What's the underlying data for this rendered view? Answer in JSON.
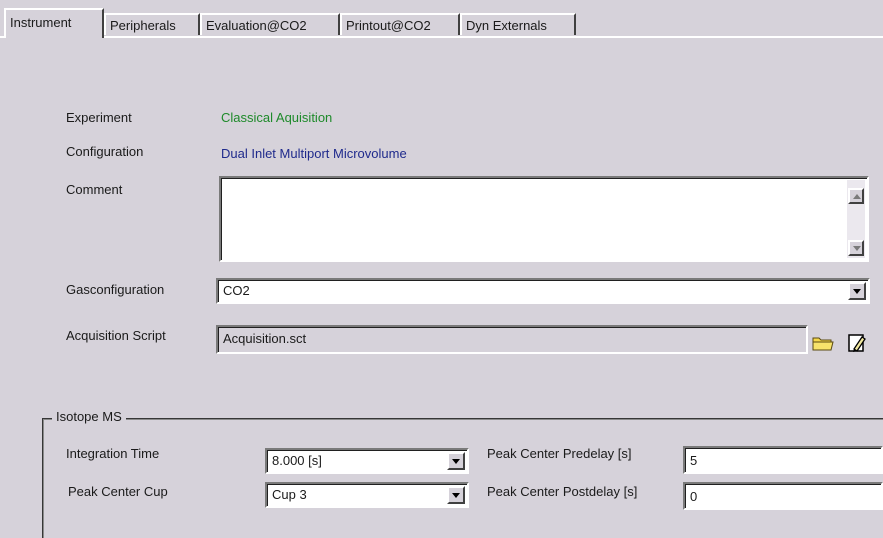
{
  "tabs": [
    {
      "label": "Instrument",
      "active": true
    },
    {
      "label": "Peripherals",
      "active": false
    },
    {
      "label": "Evaluation@CO2",
      "active": false
    },
    {
      "label": "Printout@CO2",
      "active": false
    },
    {
      "label": "Dyn Externals",
      "active": false
    }
  ],
  "instrument": {
    "experiment_label": "Experiment",
    "experiment_value": "Classical Aquisition",
    "configuration_label": "Configuration",
    "configuration_value": "Dual Inlet  Multiport  Microvolume",
    "comment_label": "Comment",
    "comment_value": "",
    "gasconfiguration_label": "Gasconfiguration",
    "gasconfiguration_value": "CO2",
    "acquisition_script_label": "Acquisition Script",
    "acquisition_script_value": "Acquisition.sct"
  },
  "isotope_ms": {
    "group_title": "Isotope MS",
    "integration_time_label": "Integration Time",
    "integration_time_value": "8.000 [s]",
    "peak_center_cup_label": "Peak Center Cup",
    "peak_center_cup_value": "Cup 3",
    "peak_center_predelay_label": "Peak Center Predelay [s]",
    "peak_center_predelay_value": "5",
    "peak_center_postdelay_label": "Peak Center Postdelay [s]",
    "peak_center_postdelay_value": "0"
  },
  "icons": {
    "browse": "folder-icon",
    "edit": "edit-pencil-icon"
  },
  "colors": {
    "background": "#d6d2da",
    "experiment_text": "#1e8a2a",
    "configuration_text": "#1f2a8c"
  }
}
